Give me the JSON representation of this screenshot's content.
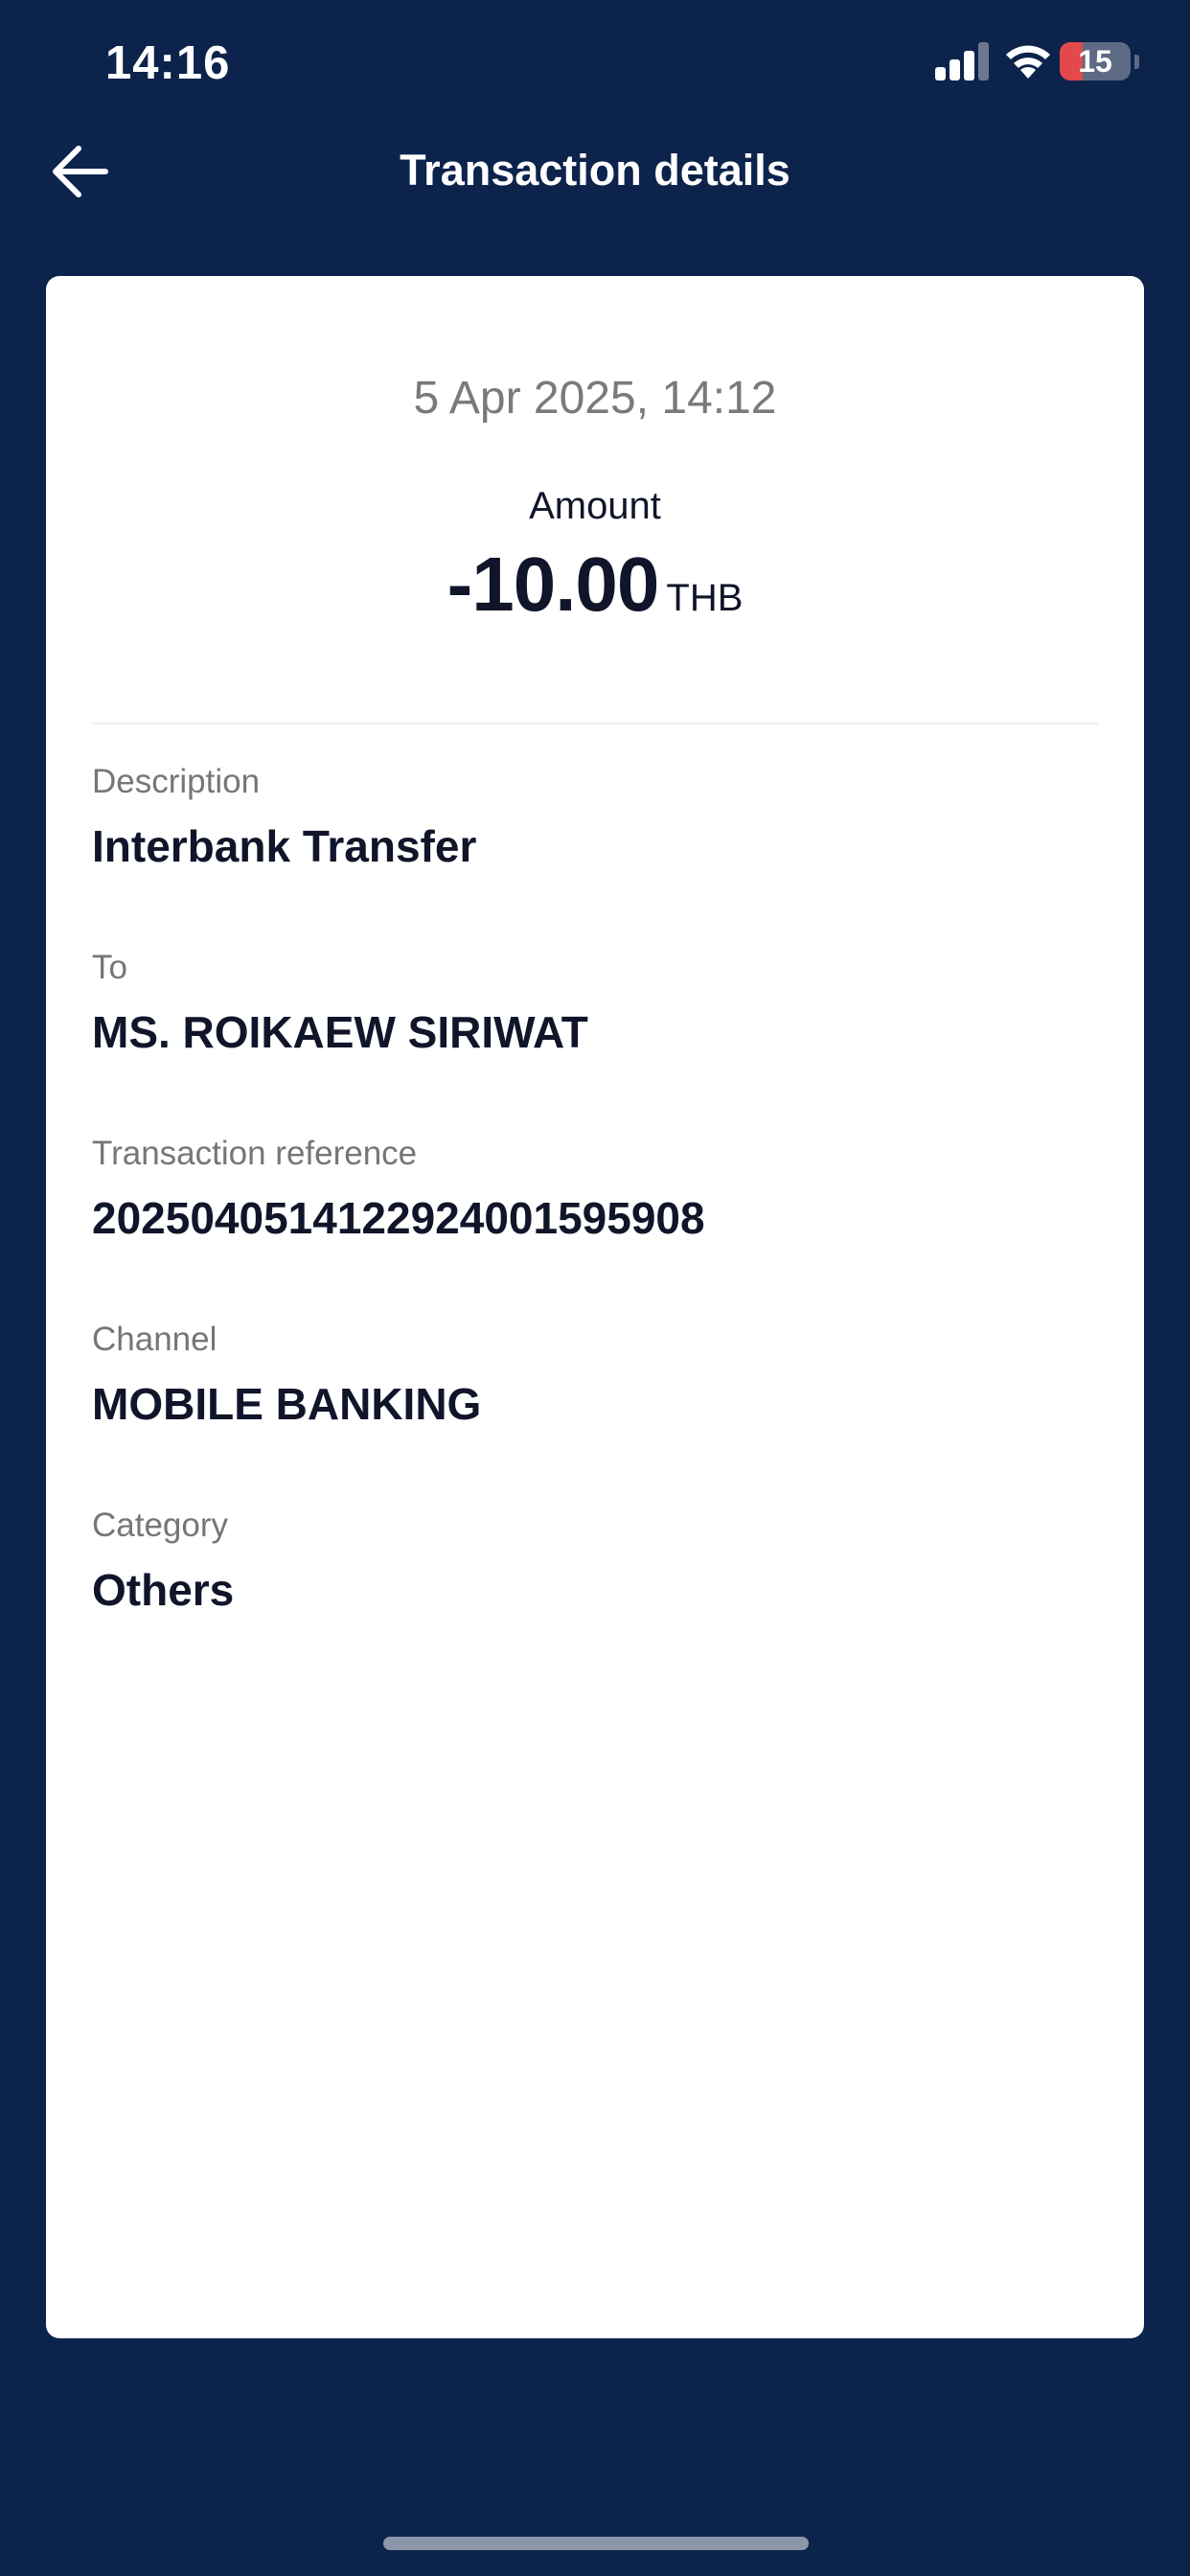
{
  "status_bar": {
    "time": "14:16",
    "battery_level": "15",
    "battery_fill_fraction": 0.15
  },
  "header": {
    "back_icon": "arrow-left-icon",
    "title": "Transaction details"
  },
  "transaction": {
    "datetime": "5 Apr 2025, 14:12",
    "amount_label": "Amount",
    "amount": "-10.00",
    "currency": "THB"
  },
  "fields": [
    {
      "label": "Description",
      "value": "Interbank Transfer"
    },
    {
      "label": "To",
      "value": "MS. ROIKAEW SIRIWAT"
    },
    {
      "label": "Transaction reference",
      "value": "20250405141229240015959​08"
    },
    {
      "label": "Channel",
      "value": "MOBILE BANKING"
    },
    {
      "label": "Category",
      "value": "Others"
    }
  ],
  "colors": {
    "background": "#0c234c",
    "card": "#ffffff",
    "text_primary": "#11152a",
    "text_secondary": "#767676",
    "battery_low": "#e3484b"
  }
}
